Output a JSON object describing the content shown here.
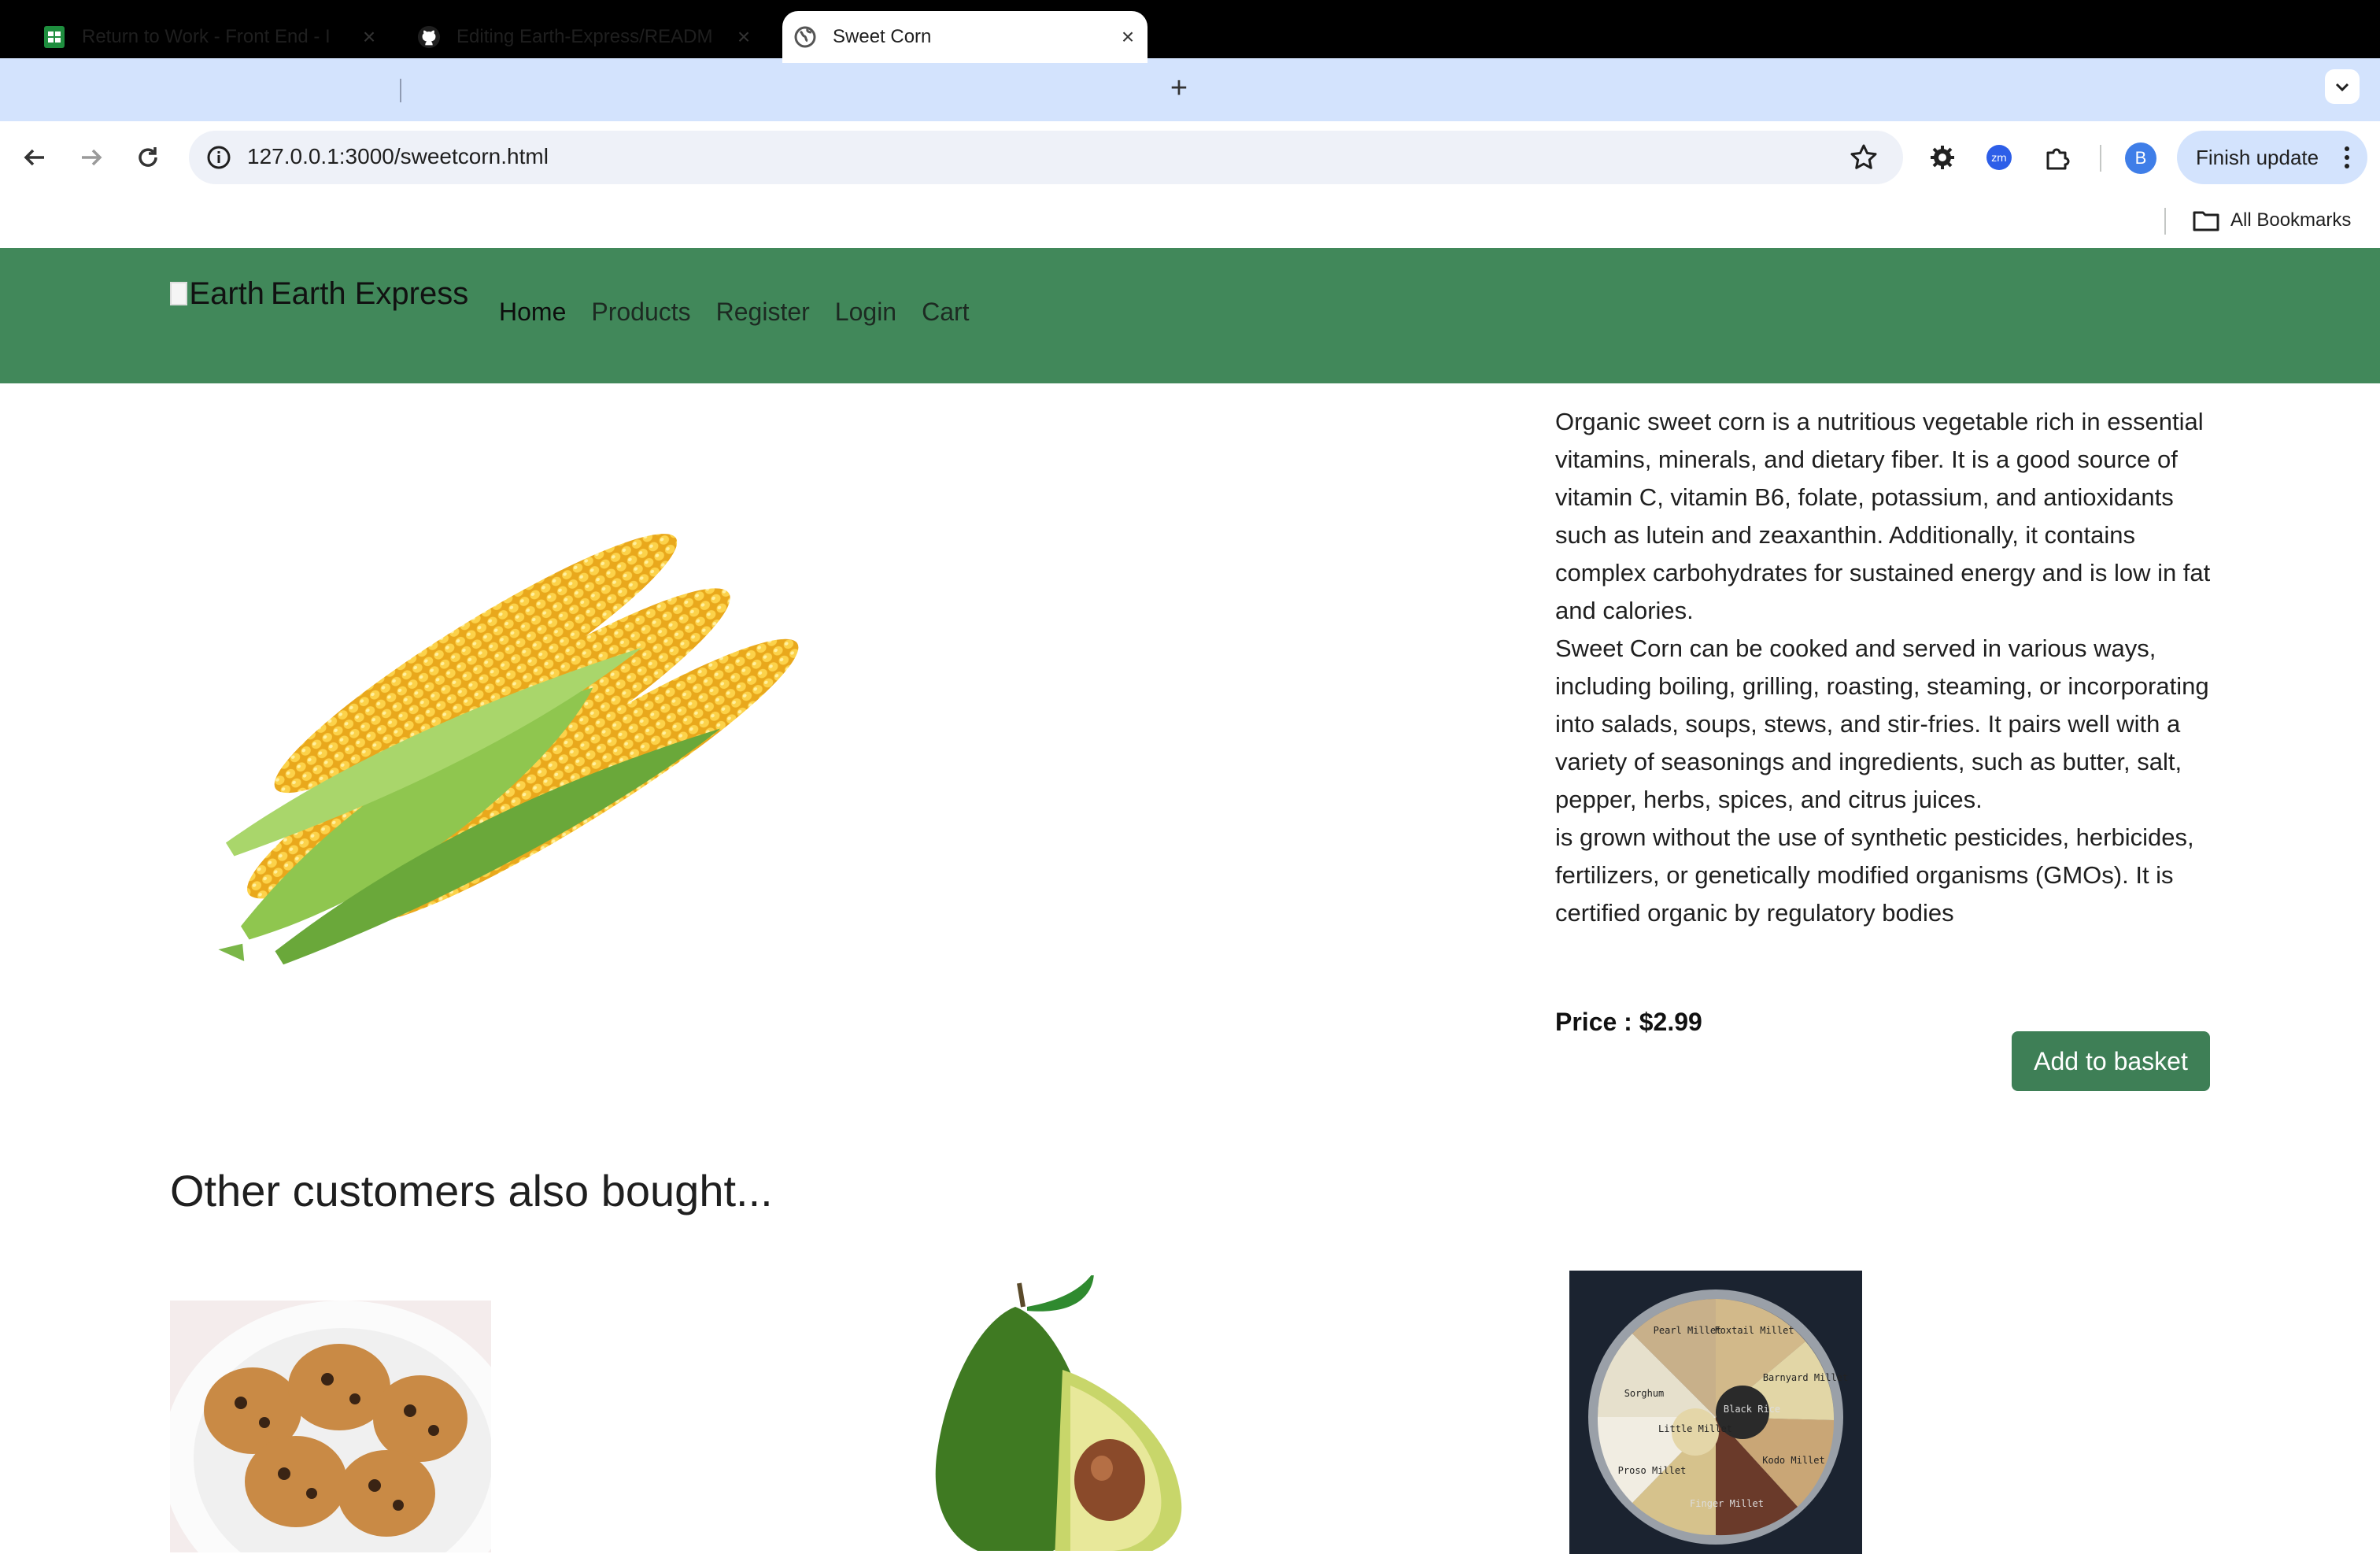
{
  "browser": {
    "tabs": [
      {
        "title": "Return to Work - Front End - I",
        "icon": "sheets-icon",
        "active": false
      },
      {
        "title": "Editing Earth-Express/READM",
        "icon": "github-icon",
        "active": false
      },
      {
        "title": "Sweet Corn",
        "icon": "globe-icon",
        "active": true
      }
    ],
    "url": "127.0.0.1:3000/sweetcorn.html",
    "profile_initial": "B",
    "finish_update_label": "Finish update",
    "bookmarks_label": "All Bookmarks",
    "ext_zoom_label": "zm"
  },
  "site": {
    "brand_alt": "Earth",
    "brand_name": "Earth Express",
    "nav": [
      "Home",
      "Products",
      "Register",
      "Login",
      "Cart"
    ],
    "header_color": "#41885a"
  },
  "product": {
    "name": "Sweet Corn",
    "description": [
      "Organic sweet corn is a nutritious vegetable rich in essential vitamins, minerals, and dietary fiber. It is a good source of vitamin C, vitamin B6, folate, potassium, and antioxidants such as lutein and zeaxanthin. Additionally, it contains complex carbohydrates for sustained energy and is low in fat and calories.",
      "Sweet Corn can be cooked and served in various ways, including boiling, grilling, roasting, steaming, or incorporating into salads, soups, stews, and stir-fries. It pairs well with a variety of seasonings and ingredients, such as butter, salt, pepper, herbs, spices, and citrus juices.",
      "is grown without the use of synthetic pesticides, herbicides, fertilizers, or genetically modified organisms (GMOs). It is certified organic by regulatory bodies"
    ],
    "price_label": "Price : $2.99",
    "add_button": "Add to basket",
    "button_color": "#3e7f56"
  },
  "also_bought": {
    "title": "Other customers also bought...",
    "millet_labels": [
      "Pearl Millet",
      "Foxtail Millet",
      "Barnyard Millet",
      "Sorghum",
      "Black Rice",
      "Little Millet",
      "Kodo Millet",
      "Proso Millet",
      "Finger Millet"
    ]
  }
}
